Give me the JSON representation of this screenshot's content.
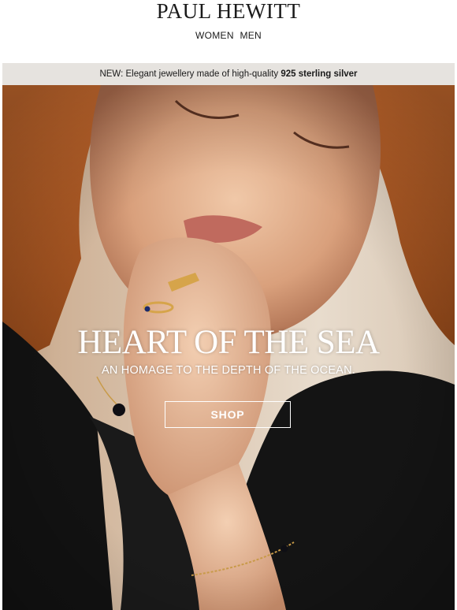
{
  "header": {
    "logo_text": "PAUL HEWITT",
    "nav": [
      {
        "label": "WOMEN"
      },
      {
        "label": "MEN"
      }
    ]
  },
  "banner": {
    "text_prefix": "NEW: Elegant jewellery made of high-quality ",
    "text_bold": "925 sterling silver"
  },
  "hero": {
    "title": "HEART OF THE SEA",
    "subtitle": "AN HOMAGE TO THE DEPTH OF THE OCEAN.",
    "button_label": "SHOP"
  },
  "colors": {
    "banner_bg": "#e6e3df",
    "text": "#1a1a1a",
    "hero_text": "#ffffff"
  }
}
